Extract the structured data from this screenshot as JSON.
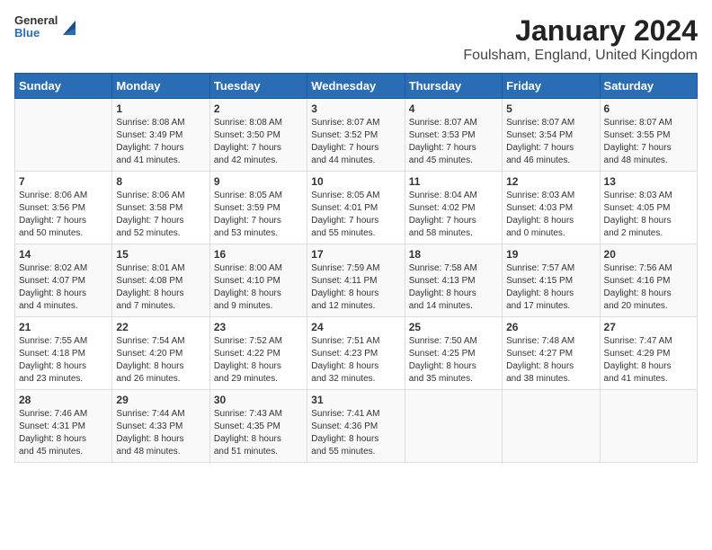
{
  "logo": {
    "general": "General",
    "blue": "Blue"
  },
  "header": {
    "title": "January 2024",
    "subtitle": "Foulsham, England, United Kingdom"
  },
  "days_of_week": [
    "Sunday",
    "Monday",
    "Tuesday",
    "Wednesday",
    "Thursday",
    "Friday",
    "Saturday"
  ],
  "weeks": [
    [
      {
        "day": "",
        "info": ""
      },
      {
        "day": "1",
        "info": "Sunrise: 8:08 AM\nSunset: 3:49 PM\nDaylight: 7 hours\nand 41 minutes."
      },
      {
        "day": "2",
        "info": "Sunrise: 8:08 AM\nSunset: 3:50 PM\nDaylight: 7 hours\nand 42 minutes."
      },
      {
        "day": "3",
        "info": "Sunrise: 8:07 AM\nSunset: 3:52 PM\nDaylight: 7 hours\nand 44 minutes."
      },
      {
        "day": "4",
        "info": "Sunrise: 8:07 AM\nSunset: 3:53 PM\nDaylight: 7 hours\nand 45 minutes."
      },
      {
        "day": "5",
        "info": "Sunrise: 8:07 AM\nSunset: 3:54 PM\nDaylight: 7 hours\nand 46 minutes."
      },
      {
        "day": "6",
        "info": "Sunrise: 8:07 AM\nSunset: 3:55 PM\nDaylight: 7 hours\nand 48 minutes."
      }
    ],
    [
      {
        "day": "7",
        "info": "Sunrise: 8:06 AM\nSunset: 3:56 PM\nDaylight: 7 hours\nand 50 minutes."
      },
      {
        "day": "8",
        "info": "Sunrise: 8:06 AM\nSunset: 3:58 PM\nDaylight: 7 hours\nand 52 minutes."
      },
      {
        "day": "9",
        "info": "Sunrise: 8:05 AM\nSunset: 3:59 PM\nDaylight: 7 hours\nand 53 minutes."
      },
      {
        "day": "10",
        "info": "Sunrise: 8:05 AM\nSunset: 4:01 PM\nDaylight: 7 hours\nand 55 minutes."
      },
      {
        "day": "11",
        "info": "Sunrise: 8:04 AM\nSunset: 4:02 PM\nDaylight: 7 hours\nand 58 minutes."
      },
      {
        "day": "12",
        "info": "Sunrise: 8:03 AM\nSunset: 4:03 PM\nDaylight: 8 hours\nand 0 minutes."
      },
      {
        "day": "13",
        "info": "Sunrise: 8:03 AM\nSunset: 4:05 PM\nDaylight: 8 hours\nand 2 minutes."
      }
    ],
    [
      {
        "day": "14",
        "info": "Sunrise: 8:02 AM\nSunset: 4:07 PM\nDaylight: 8 hours\nand 4 minutes."
      },
      {
        "day": "15",
        "info": "Sunrise: 8:01 AM\nSunset: 4:08 PM\nDaylight: 8 hours\nand 7 minutes."
      },
      {
        "day": "16",
        "info": "Sunrise: 8:00 AM\nSunset: 4:10 PM\nDaylight: 8 hours\nand 9 minutes."
      },
      {
        "day": "17",
        "info": "Sunrise: 7:59 AM\nSunset: 4:11 PM\nDaylight: 8 hours\nand 12 minutes."
      },
      {
        "day": "18",
        "info": "Sunrise: 7:58 AM\nSunset: 4:13 PM\nDaylight: 8 hours\nand 14 minutes."
      },
      {
        "day": "19",
        "info": "Sunrise: 7:57 AM\nSunset: 4:15 PM\nDaylight: 8 hours\nand 17 minutes."
      },
      {
        "day": "20",
        "info": "Sunrise: 7:56 AM\nSunset: 4:16 PM\nDaylight: 8 hours\nand 20 minutes."
      }
    ],
    [
      {
        "day": "21",
        "info": "Sunrise: 7:55 AM\nSunset: 4:18 PM\nDaylight: 8 hours\nand 23 minutes."
      },
      {
        "day": "22",
        "info": "Sunrise: 7:54 AM\nSunset: 4:20 PM\nDaylight: 8 hours\nand 26 minutes."
      },
      {
        "day": "23",
        "info": "Sunrise: 7:52 AM\nSunset: 4:22 PM\nDaylight: 8 hours\nand 29 minutes."
      },
      {
        "day": "24",
        "info": "Sunrise: 7:51 AM\nSunset: 4:23 PM\nDaylight: 8 hours\nand 32 minutes."
      },
      {
        "day": "25",
        "info": "Sunrise: 7:50 AM\nSunset: 4:25 PM\nDaylight: 8 hours\nand 35 minutes."
      },
      {
        "day": "26",
        "info": "Sunrise: 7:48 AM\nSunset: 4:27 PM\nDaylight: 8 hours\nand 38 minutes."
      },
      {
        "day": "27",
        "info": "Sunrise: 7:47 AM\nSunset: 4:29 PM\nDaylight: 8 hours\nand 41 minutes."
      }
    ],
    [
      {
        "day": "28",
        "info": "Sunrise: 7:46 AM\nSunset: 4:31 PM\nDaylight: 8 hours\nand 45 minutes."
      },
      {
        "day": "29",
        "info": "Sunrise: 7:44 AM\nSunset: 4:33 PM\nDaylight: 8 hours\nand 48 minutes."
      },
      {
        "day": "30",
        "info": "Sunrise: 7:43 AM\nSunset: 4:35 PM\nDaylight: 8 hours\nand 51 minutes."
      },
      {
        "day": "31",
        "info": "Sunrise: 7:41 AM\nSunset: 4:36 PM\nDaylight: 8 hours\nand 55 minutes."
      },
      {
        "day": "",
        "info": ""
      },
      {
        "day": "",
        "info": ""
      },
      {
        "day": "",
        "info": ""
      }
    ]
  ]
}
